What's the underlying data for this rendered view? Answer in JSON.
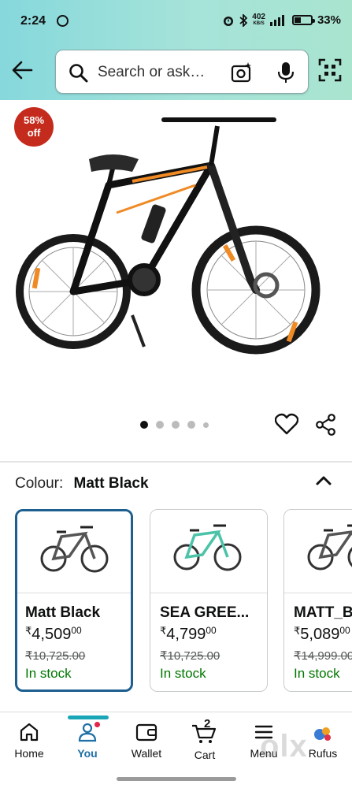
{
  "status_bar": {
    "time": "2:24",
    "network_speed_value": "402",
    "network_speed_unit": "KB/S",
    "battery": "33%"
  },
  "search": {
    "placeholder": "Search or ask…"
  },
  "product": {
    "discount_badge_line1": "58%",
    "discount_badge_line2": "off",
    "image_count": 5,
    "active_image_index": 0
  },
  "colour_selector": {
    "label": "Colour:",
    "selected": "Matt Black",
    "options": [
      {
        "name": "Matt Black",
        "currency": "₹",
        "price": "4,509",
        "price_fraction": "00",
        "mrp": "₹10,725.00",
        "stock": "In stock",
        "frame_color": "#555555",
        "accent_color": "#777777"
      },
      {
        "name": "SEA GREE...",
        "currency": "₹",
        "price": "4,799",
        "price_fraction": "00",
        "mrp": "₹10,725.00",
        "stock": "In stock",
        "frame_color": "#4cc3a8",
        "accent_color": "#2aa88a"
      },
      {
        "name": "MATT_B",
        "currency": "₹",
        "price": "5,089",
        "price_fraction": "00",
        "mrp": "₹14,999.00",
        "stock": "In stock",
        "frame_color": "#555555",
        "accent_color": "#e0802b"
      }
    ]
  },
  "bottom_nav": {
    "items": [
      {
        "label": "Home"
      },
      {
        "label": "You"
      },
      {
        "label": "Wallet"
      },
      {
        "label": "Cart",
        "badge": "2"
      },
      {
        "label": "Menu"
      },
      {
        "label": "Rufus"
      }
    ],
    "active": "You"
  },
  "colors": {
    "header_gradient_start": "#86d8dc",
    "header_gradient_end": "#a9e4cf",
    "discount_badge": "#c42b1c",
    "in_stock": "#007600",
    "selected_border": "#1d5f8f",
    "nav_active": "#1d6fa5"
  },
  "watermark": "olx"
}
